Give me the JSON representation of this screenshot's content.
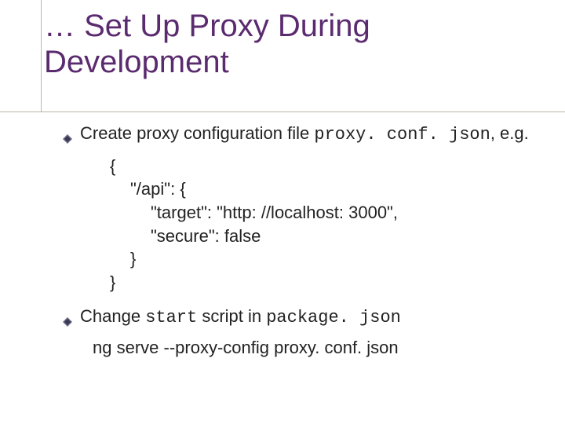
{
  "title": "… Set Up Proxy During Development",
  "items": [
    {
      "text_before": "Create proxy configuration file ",
      "mono1": "proxy. conf. json",
      "text_mid": ", e.g.",
      "code": {
        "l1": "{",
        "l2": "\"/api\": {",
        "l3": "\"target\": \"http: //localhost: 3000\",",
        "l4": "\"secure\": false",
        "l5": "}",
        "l6": "}"
      }
    },
    {
      "text_before": "Change ",
      "mono1": "start",
      "text_mid": " script in ",
      "mono2": "package. json",
      "cmd": "ng serve --proxy-config proxy. conf. json"
    }
  ]
}
